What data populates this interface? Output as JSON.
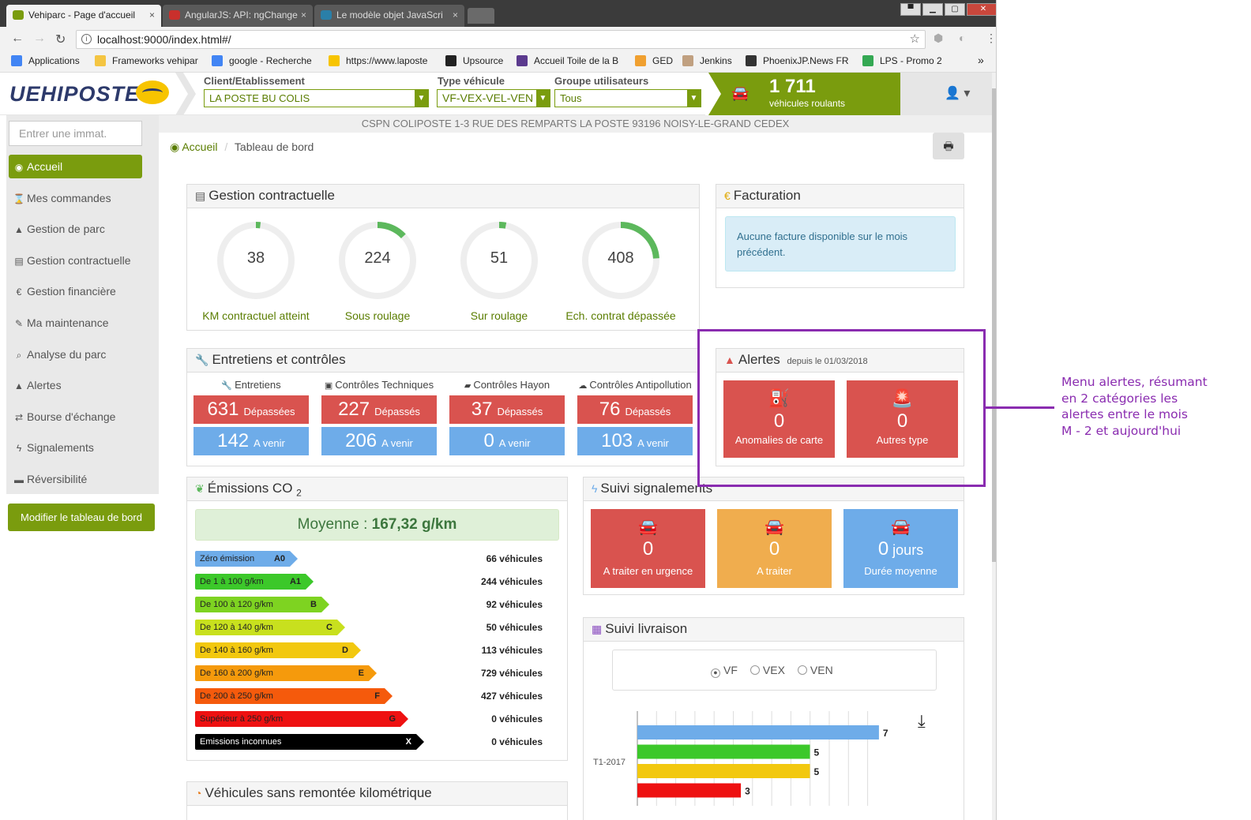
{
  "browser": {
    "tabs": [
      {
        "label": "Vehiparc - Page d'accueil",
        "close": "×",
        "active": true,
        "icon_color": "#7a9c0e"
      },
      {
        "label": "AngularJS: API: ngChange",
        "close": "×",
        "active": false,
        "icon_color": "#c9302c"
      },
      {
        "label": "Le modèle objet JavaScri",
        "close": "×",
        "active": false,
        "icon_color": "#2a7fa8"
      }
    ],
    "url": "localhost:9000/index.html#/",
    "bookmarks": [
      {
        "label": "Applications",
        "icon_color": "#4285f4"
      },
      {
        "label": "Frameworks vehipar",
        "icon_color": "#f4c542"
      },
      {
        "label": "google - Recherche",
        "icon_color": "#4285f4"
      },
      {
        "label": "https://www.laposte",
        "icon_color": "#f7c400"
      },
      {
        "label": "Upsource",
        "icon_color": "#222222"
      },
      {
        "label": "Accueil Toile de la B",
        "icon_color": "#5b3a8e"
      },
      {
        "label": "GED",
        "icon_color": "#f0a030"
      },
      {
        "label": "Jenkins",
        "icon_color": "#c0a080"
      },
      {
        "label": "PhoenixJP.News FR",
        "icon_color": "#333333"
      },
      {
        "label": "LPS - Promo 2",
        "icon_color": "#34a853"
      }
    ],
    "bookmarks_more": "»"
  },
  "header": {
    "logo": "UEHIPOSTE",
    "client_label": "Client/Etablissement",
    "client_value": "LA POSTE BU COLIS",
    "type_label": "Type véhicule",
    "type_value": "VF-VEX-VEL-VEN",
    "groupe_label": "Groupe utilisateurs",
    "groupe_value": "Tous",
    "counter_value": "1 711",
    "counter_label": "véhicules roulants"
  },
  "sidebar": {
    "search_placeholder": "Entrer une immat.",
    "items": [
      {
        "label": "Accueil",
        "icon": "dashboard-icon",
        "glyph": "◉",
        "active": true
      },
      {
        "label": "Mes commandes",
        "icon": "hourglass-icon",
        "glyph": "⌛",
        "active": false
      },
      {
        "label": "Gestion de parc",
        "icon": "road-icon",
        "glyph": "▲",
        "active": false
      },
      {
        "label": "Gestion contractuelle",
        "icon": "file-icon",
        "glyph": "▤",
        "active": false
      },
      {
        "label": "Gestion financière",
        "icon": "euro-icon",
        "glyph": "€",
        "active": false
      },
      {
        "label": "Ma maintenance",
        "icon": "wrench-icon",
        "glyph": "✎",
        "active": false
      },
      {
        "label": "Analyse du parc",
        "icon": "search-icon",
        "glyph": "⌕",
        "active": false
      },
      {
        "label": "Alertes",
        "icon": "warning-icon",
        "glyph": "▲",
        "active": false
      },
      {
        "label": "Bourse d'échange",
        "icon": "exchange-icon",
        "glyph": "⇄",
        "active": false
      },
      {
        "label": "Signalements",
        "icon": "flash-icon",
        "glyph": "ϟ",
        "active": false
      },
      {
        "label": "Réversibilité",
        "icon": "archive-icon",
        "glyph": "▬",
        "active": false
      }
    ],
    "modify_button": "Modifier le tableau de bord"
  },
  "main": {
    "address": "CSPN COLIPOSTE 1-3 RUE DES REMPARTS LA POSTE 93196 NOISY-LE-GRAND CEDEX",
    "breadcrumb_home": "Accueil",
    "breadcrumb_sep": "/",
    "breadcrumb_current": "Tableau de bord"
  },
  "gestion": {
    "title": "Gestion contractuelle",
    "gauges": [
      {
        "value": "38",
        "label": "KM contractuel atteint",
        "fraction": 0.02
      },
      {
        "value": "224",
        "label": "Sous roulage",
        "fraction": 0.13
      },
      {
        "value": "51",
        "label": "Sur roulage",
        "fraction": 0.03
      },
      {
        "value": "408",
        "label": "Ech. contrat dépassée",
        "fraction": 0.24
      }
    ]
  },
  "facturation": {
    "title": "Facturation",
    "message": "Aucune facture disponible sur le mois précédent."
  },
  "entretiens": {
    "title": "Entretiens et contrôles",
    "columns": [
      {
        "head": "Entretiens",
        "icon": "wrench-icon",
        "depasses": "631",
        "depasses_label": "Dépassées",
        "venir": "142",
        "venir_label": "A venir"
      },
      {
        "head": "Contrôles Techniques",
        "icon": "monitor-icon",
        "depasses": "227",
        "depasses_label": "Dépassés",
        "venir": "206",
        "venir_label": "A venir"
      },
      {
        "head": "Contrôles Hayon",
        "icon": "truck-icon",
        "depasses": "37",
        "depasses_label": "Dépassés",
        "venir": "0",
        "venir_label": "A venir"
      },
      {
        "head": "Contrôles Antipollution",
        "icon": "cloud-icon",
        "depasses": "76",
        "depasses_label": "Dépassés",
        "venir": "103",
        "venir_label": "A venir"
      }
    ]
  },
  "alertes": {
    "title": "Alertes",
    "since": "depuis le 01/03/2018",
    "boxes": [
      {
        "value": "0",
        "label": "Anomalies de carte",
        "icon": "fuel-pump-icon"
      },
      {
        "value": "0",
        "label": "Autres type",
        "icon": "siren-icon"
      }
    ]
  },
  "co2": {
    "title": "Émissions CO",
    "title_sub": "2",
    "average_label": "Moyenne : ",
    "average_value": "167,32 g/km",
    "rows": [
      {
        "label": "Zéro émission",
        "cls": "A0",
        "count": "66 véhicules",
        "color": "#6eace9",
        "text_color": "#222",
        "len": 120
      },
      {
        "label": "De 1 à 100 g/km",
        "cls": "A1",
        "count": "244 véhicules",
        "color": "#3cc82a",
        "text_color": "#222",
        "len": 140
      },
      {
        "label": "De 100 à 120 g/km",
        "cls": "B",
        "count": "92 véhicules",
        "color": "#7ed321",
        "text_color": "#222",
        "len": 160
      },
      {
        "label": "De 120 à 140 g/km",
        "cls": "C",
        "count": "50 véhicules",
        "color": "#c8e01e",
        "text_color": "#222",
        "len": 180
      },
      {
        "label": "De 140 à 160 g/km",
        "cls": "D",
        "count": "113 véhicules",
        "color": "#f2c80f",
        "text_color": "#222",
        "len": 200
      },
      {
        "label": "De 160 à 200 g/km",
        "cls": "E",
        "count": "729 véhicules",
        "color": "#f59a0c",
        "text_color": "#222",
        "len": 220
      },
      {
        "label": "De 200 à 250 g/km",
        "cls": "F",
        "count": "427 véhicules",
        "color": "#f55a0c",
        "text_color": "#222",
        "len": 240
      },
      {
        "label": "Supérieur à 250 g/km",
        "cls": "G",
        "count": "0 véhicules",
        "color": "#ee1111",
        "text_color": "#222",
        "len": 260
      },
      {
        "label": "Emissions inconnues",
        "cls": "X",
        "count": "0 véhicules",
        "color": "#000000",
        "text_color": "#ffffff",
        "len": 280
      }
    ]
  },
  "signalements": {
    "title": "Suivi signalements",
    "boxes": [
      {
        "value": "0",
        "suffix": "",
        "label": "A traiter en urgence",
        "color": "#d9534f"
      },
      {
        "value": "0",
        "suffix": "",
        "label": "A traiter",
        "color": "#f0ad4e"
      },
      {
        "value": "0",
        "suffix": " jours",
        "label": "Durée moyenne",
        "color": "#6eace9"
      }
    ]
  },
  "livraison": {
    "title": "Suivi livraison",
    "radios": [
      {
        "label": "VF",
        "checked": true
      },
      {
        "label": "VEX",
        "checked": false
      },
      {
        "label": "VEN",
        "checked": false
      }
    ]
  },
  "sans_remontee": {
    "title": "Véhicules sans remontée kilométrique"
  },
  "chart_data": {
    "type": "bar",
    "orientation": "horizontal",
    "categories": [
      "T1-2017"
    ],
    "series": [
      {
        "values": [
          7
        ],
        "color": "#6eace9"
      },
      {
        "values": [
          5
        ],
        "color": "#3cc82a"
      },
      {
        "values": [
          5
        ],
        "color": "#f2c80f"
      },
      {
        "values": [
          3
        ],
        "color": "#ee1111"
      }
    ],
    "xlim": [
      0,
      7
    ],
    "grid": true
  },
  "annotation": {
    "lines": [
      "Menu alertes, résumant",
      "en 2 catégories les",
      "alertes entre le mois",
      "M - 2 et aujourd'hui"
    ],
    "color": "#8a2cb0"
  }
}
